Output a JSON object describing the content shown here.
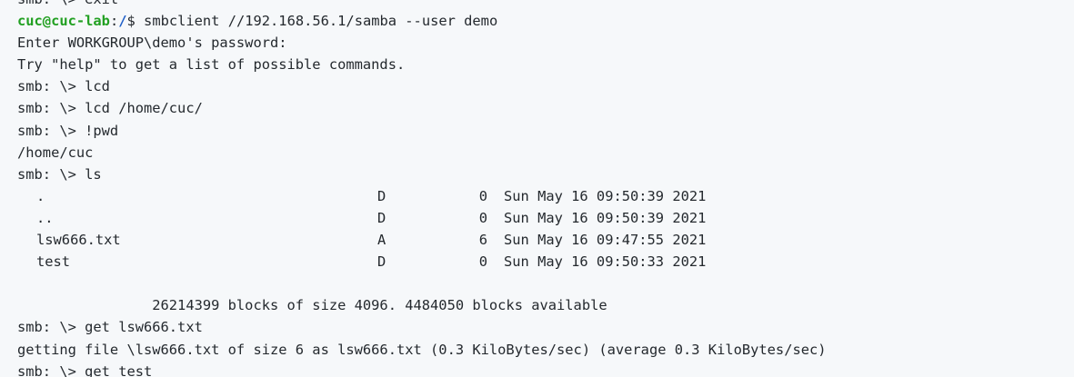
{
  "terminal": {
    "top_partial_line": "smb: \\> exit",
    "prompt": {
      "user_host": "cuc@cuc-lab",
      "colon": ":",
      "path": "/",
      "symbol": "$ ",
      "command": "smbclient //192.168.56.1/samba --user demo"
    },
    "lines_before_listing": [
      "Enter WORKGROUP\\demo's password:",
      "Try \"help\" to get a list of possible commands.",
      "smb: \\> lcd",
      "smb: \\> lcd /home/cuc/",
      "smb: \\> !pwd",
      "/home/cuc",
      "smb: \\> ls"
    ],
    "listing": [
      {
        "name": ".",
        "attr": "D",
        "size": "0",
        "date": "Sun May 16 09:50:39 2021"
      },
      {
        "name": "..",
        "attr": "D",
        "size": "0",
        "date": "Sun May 16 09:50:39 2021"
      },
      {
        "name": "lsw666.txt",
        "attr": "A",
        "size": "6",
        "date": "Sun May 16 09:47:55 2021"
      },
      {
        "name": "test",
        "attr": "D",
        "size": "0",
        "date": "Sun May 16 09:50:33 2021"
      }
    ],
    "blocks_summary": "                26214399 blocks of size 4096. 4484050 blocks available",
    "lines_after_listing": [
      "smb: \\> get lsw666.txt",
      "getting file \\lsw666.txt of size 6 as lsw666.txt (0.3 KiloBytes/sec) (average 0.3 KiloBytes/sec)",
      "smb: \\> get test"
    ]
  },
  "colors": {
    "background": "#f6f8fa",
    "text": "#24292e",
    "user_host": "#22a022",
    "path": "#1f5fc8"
  }
}
